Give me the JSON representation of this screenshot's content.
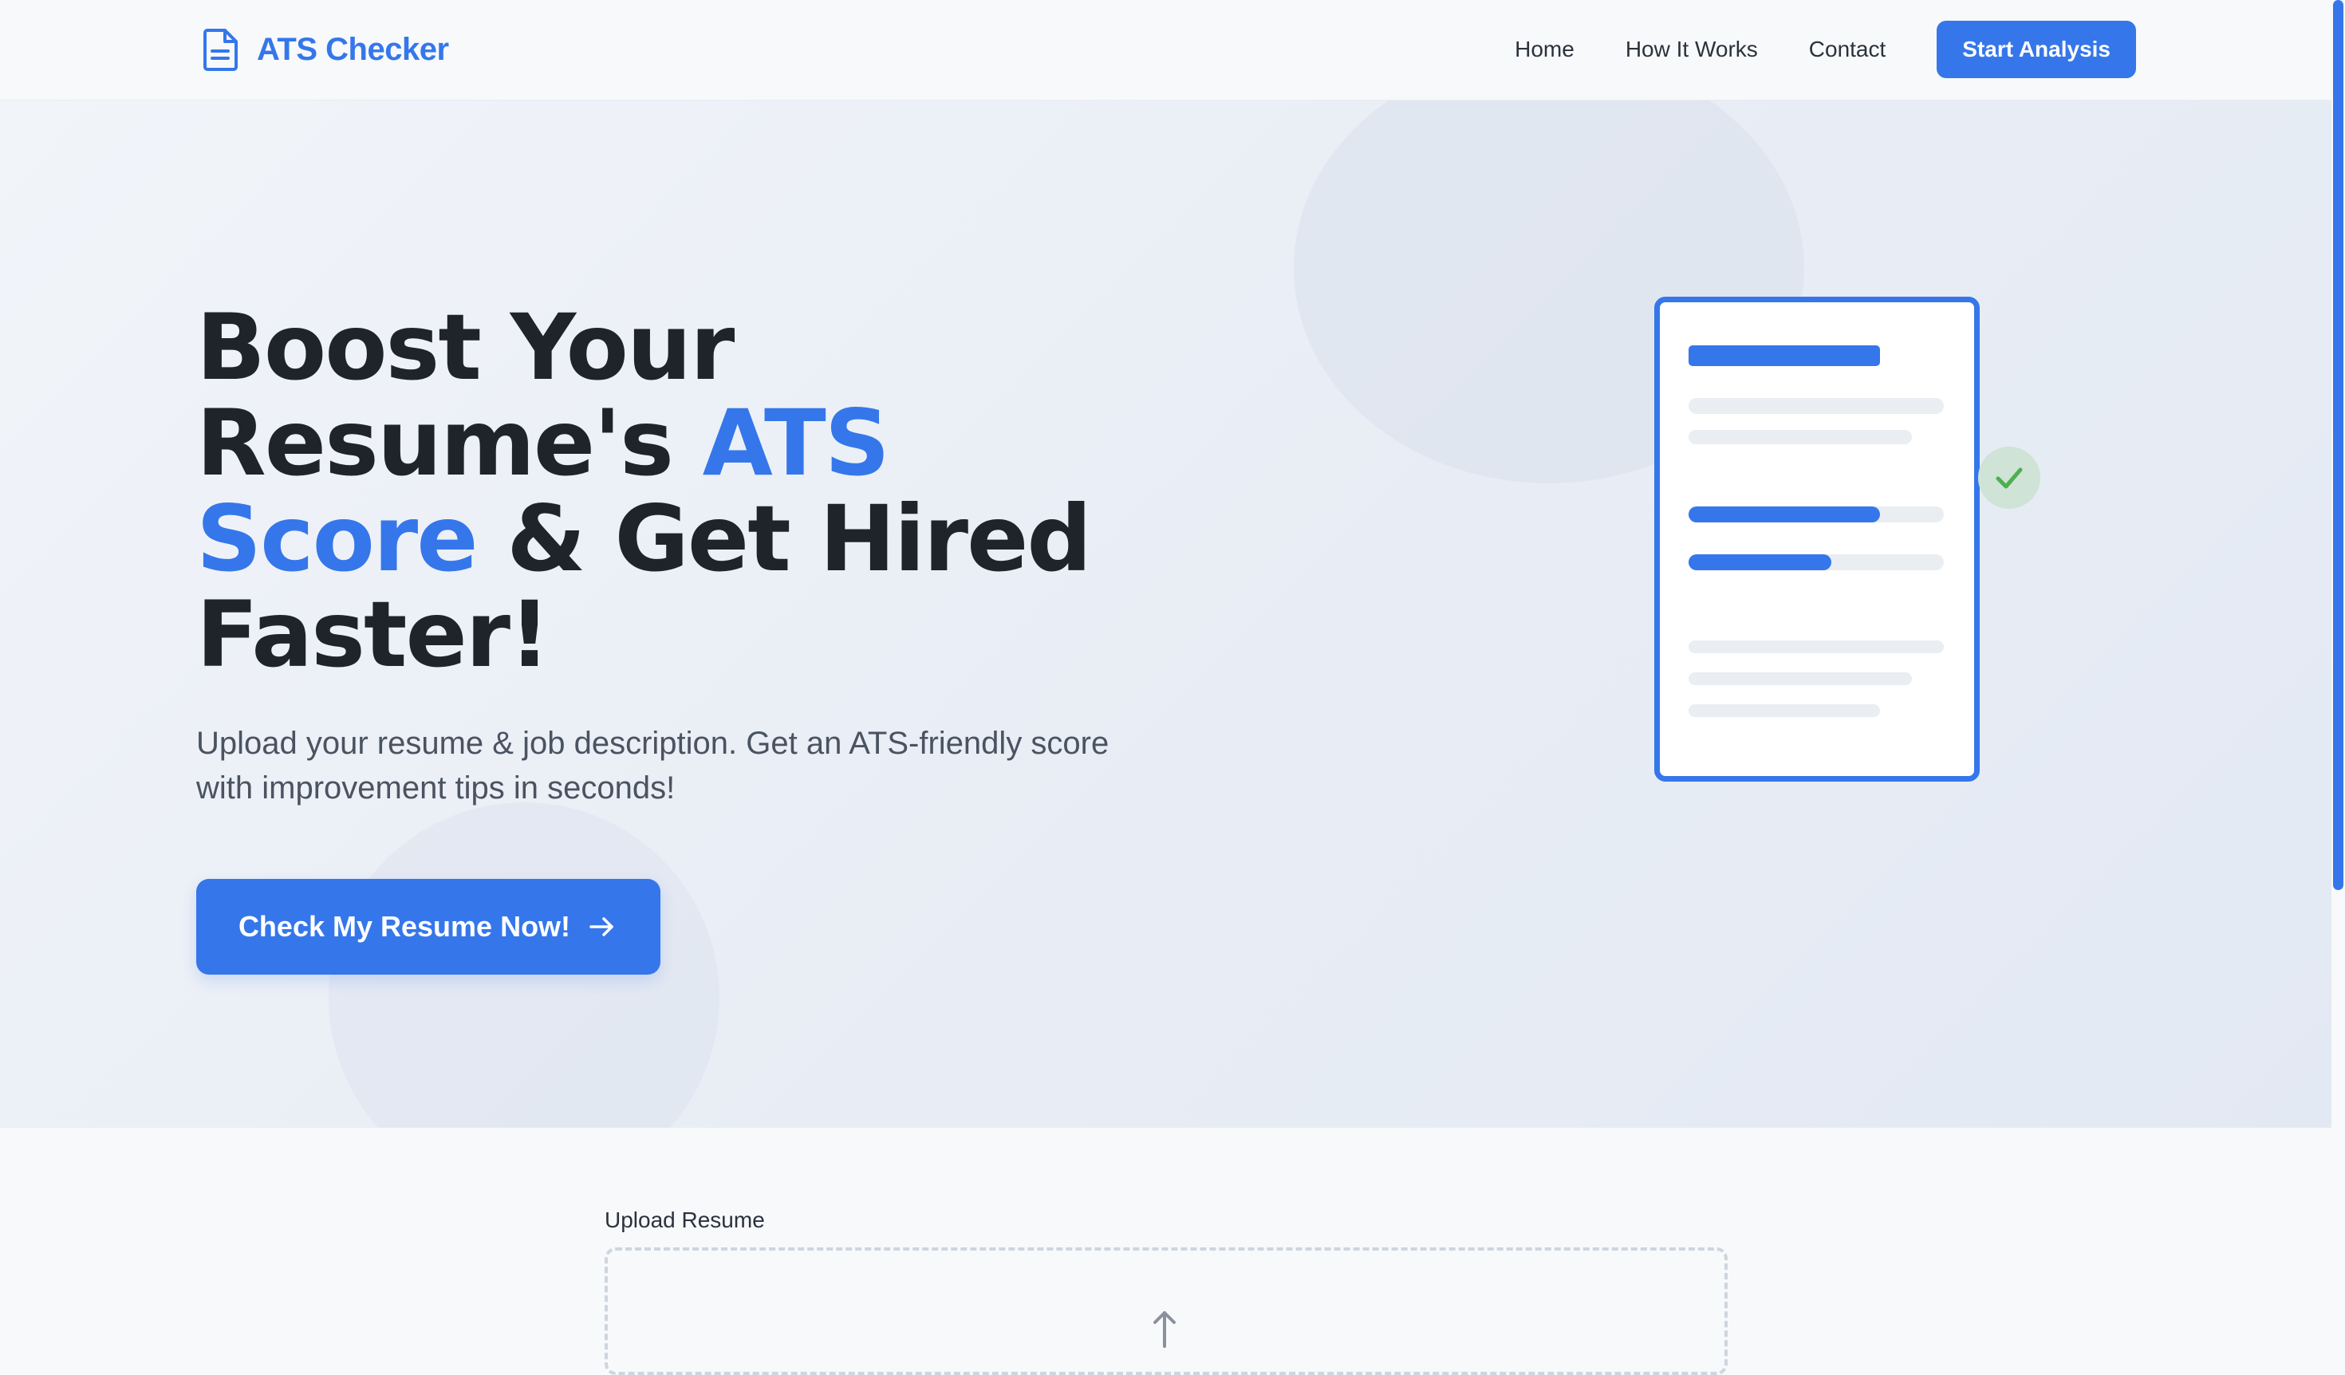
{
  "brand": {
    "name": "ATS Checker",
    "icon": "document-icon"
  },
  "nav": {
    "links": [
      "Home",
      "How It Works",
      "Contact"
    ],
    "cta": "Start Analysis"
  },
  "hero": {
    "title_part1": "Boost Your Resume's ",
    "title_accent": "ATS Score",
    "title_part2": " & Get Hired Faster!",
    "subtitle": "Upload your resume & job description. Get an ATS-friendly score with improvement tips in seconds!",
    "cta": "Check My Resume Now!",
    "cta_icon": "arrow-right-icon"
  },
  "illustration": {
    "progress": [
      0.75,
      0.56
    ],
    "badge_icon": "check-icon"
  },
  "upload": {
    "label": "Upload Resume",
    "icon": "upload-icon"
  },
  "colors": {
    "primary": "#3577ea",
    "text": "#1f242b",
    "muted": "#4a5361",
    "success": "#4caf50"
  }
}
